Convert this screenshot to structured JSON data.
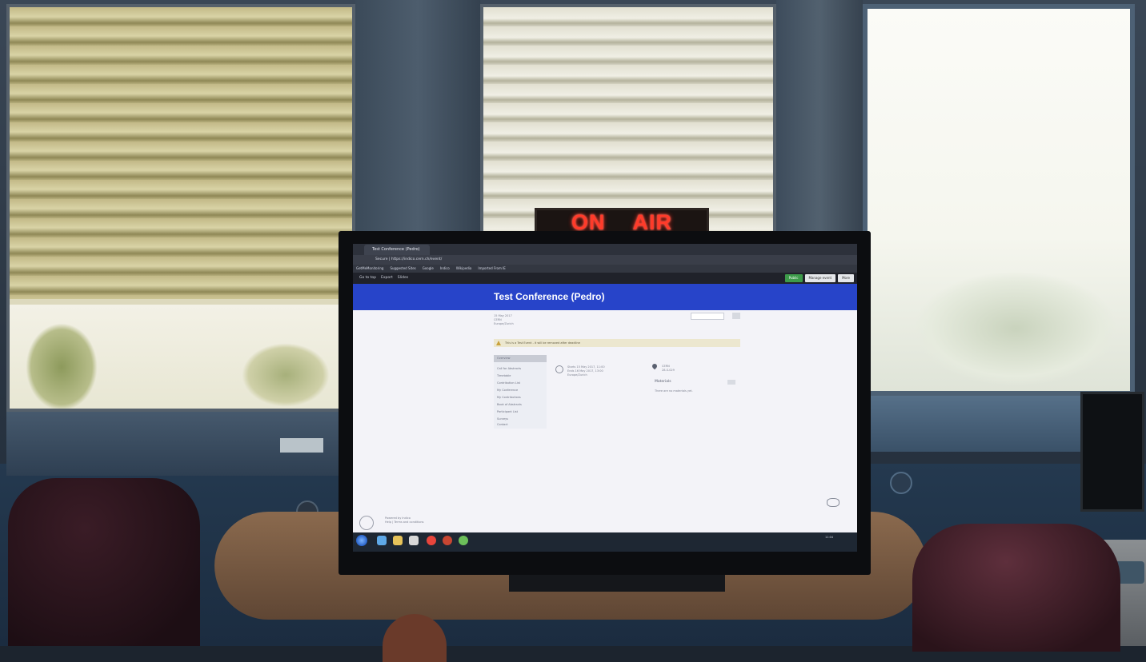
{
  "sign": {
    "word1": "ON",
    "word2": "AIR"
  },
  "browser": {
    "tab_title": "Test Conference (Pedro)",
    "address": "Secure | https://indico.cern.ch/event/",
    "bookmarks": [
      "GetMeMonitoring",
      "Suggested Sites",
      "Google",
      "Indico",
      "Wikipedia",
      "Imported From IE"
    ],
    "toolbar_items": [
      "Go to top",
      "Export",
      "Slides"
    ],
    "toolbar_right": [
      "Public",
      "Manage event",
      "More"
    ]
  },
  "page": {
    "title": "Test Conference (Pedro)",
    "date_lines": [
      "15 May 2017",
      "CERN",
      "Europe/Zurich"
    ],
    "notice": "This is a Test Event - it will be removed after deadline",
    "sidebar_items": [
      "Overview",
      "Call for Abstracts",
      "Timetable",
      "Contribution List",
      "My Conference",
      "My Contributions",
      "Book of Abstracts",
      "Participant List",
      "Surveys",
      "Contact"
    ],
    "times_start": "Starts 15 May 2017, 11:00",
    "times_end": "Ends 16 May 2017, 13:00",
    "times_tz": "Europe/Zurich",
    "location": "CERN",
    "location_room": "28-S-029",
    "materials_label": "Materials",
    "materials_text": "There are no materials yet.",
    "footer_line1": "Powered by Indico",
    "footer_line2": "Help | Terms and conditions"
  },
  "taskbar": {
    "clock": "11:04"
  },
  "colors": {
    "banner": "#2744c9",
    "sign_text": "#ff3b2a"
  }
}
